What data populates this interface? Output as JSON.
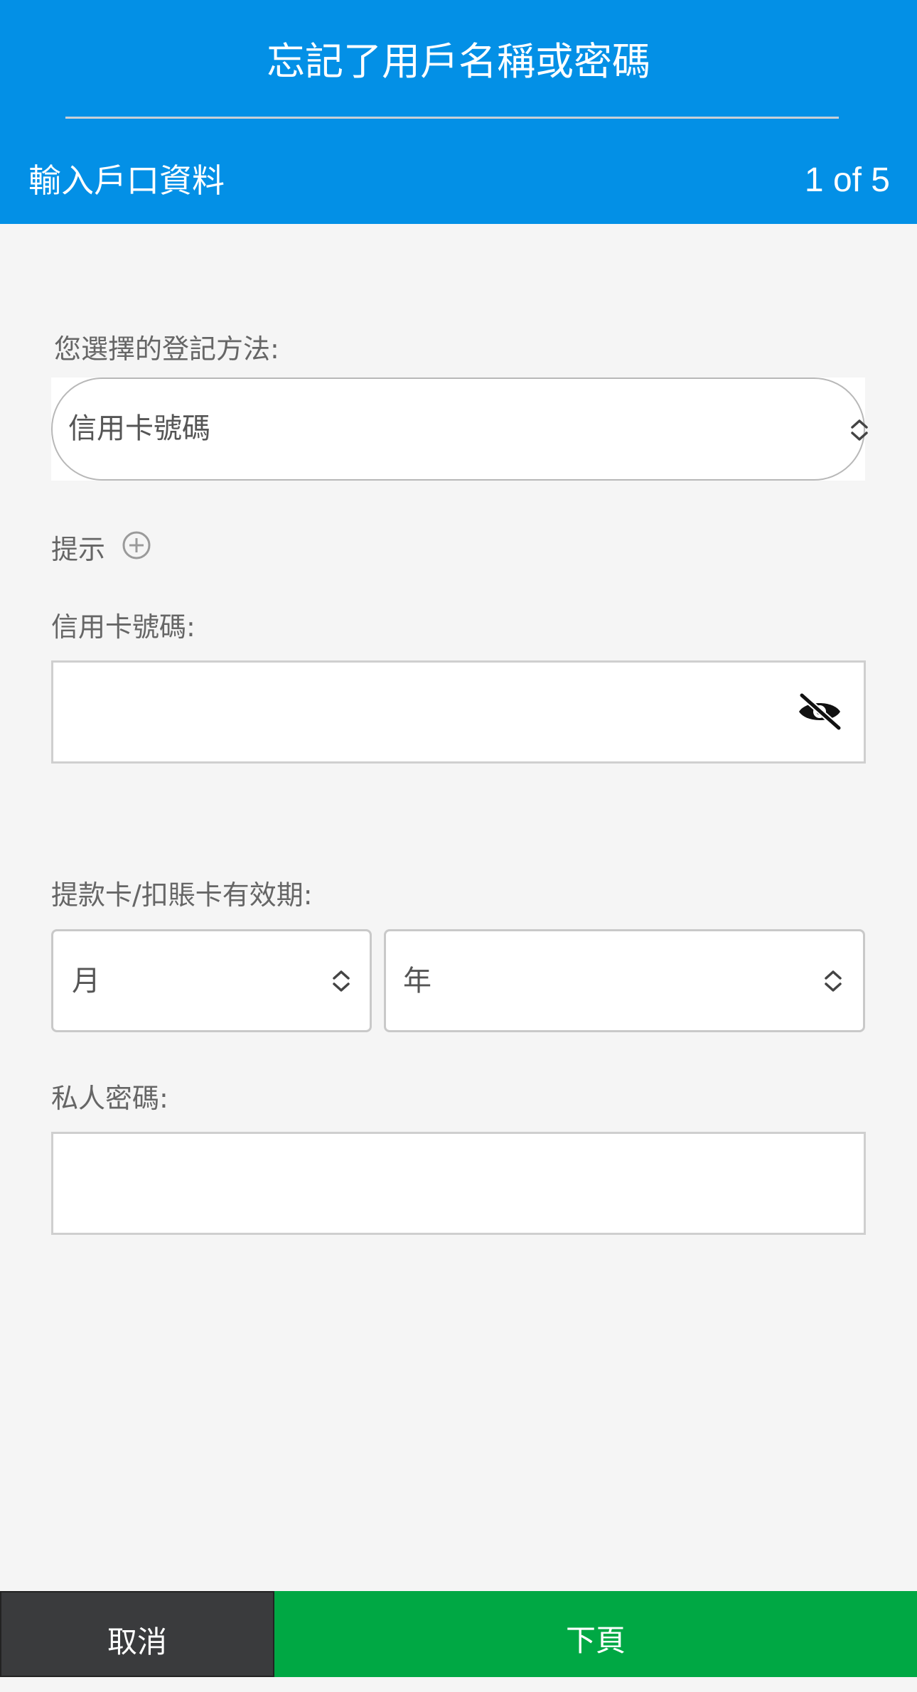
{
  "header": {
    "title": "忘記了用戶名稱或密碼",
    "step_title": "輸入戶口資料",
    "step_count": "1 of 5"
  },
  "form": {
    "method": {
      "label": "您選擇的登記方法:",
      "selected": "信用卡號碼"
    },
    "hint": {
      "label": "提示",
      "icon": "plus-circle-icon"
    },
    "card_number": {
      "label": "信用卡號碼:",
      "value": "",
      "icon": "eye-slash-icon"
    },
    "expiry": {
      "label": "提款卡/扣賬卡有效期:",
      "month": "月",
      "year": "年"
    },
    "pin": {
      "label": "私人密碼:",
      "value": ""
    }
  },
  "footer": {
    "cancel_label": "取消",
    "next_label": "下頁"
  },
  "colors": {
    "header_bg": "#0390e6",
    "page_bg": "#f5f5f5",
    "cancel_bg": "#3a3b3d",
    "next_bg": "#00a844"
  }
}
